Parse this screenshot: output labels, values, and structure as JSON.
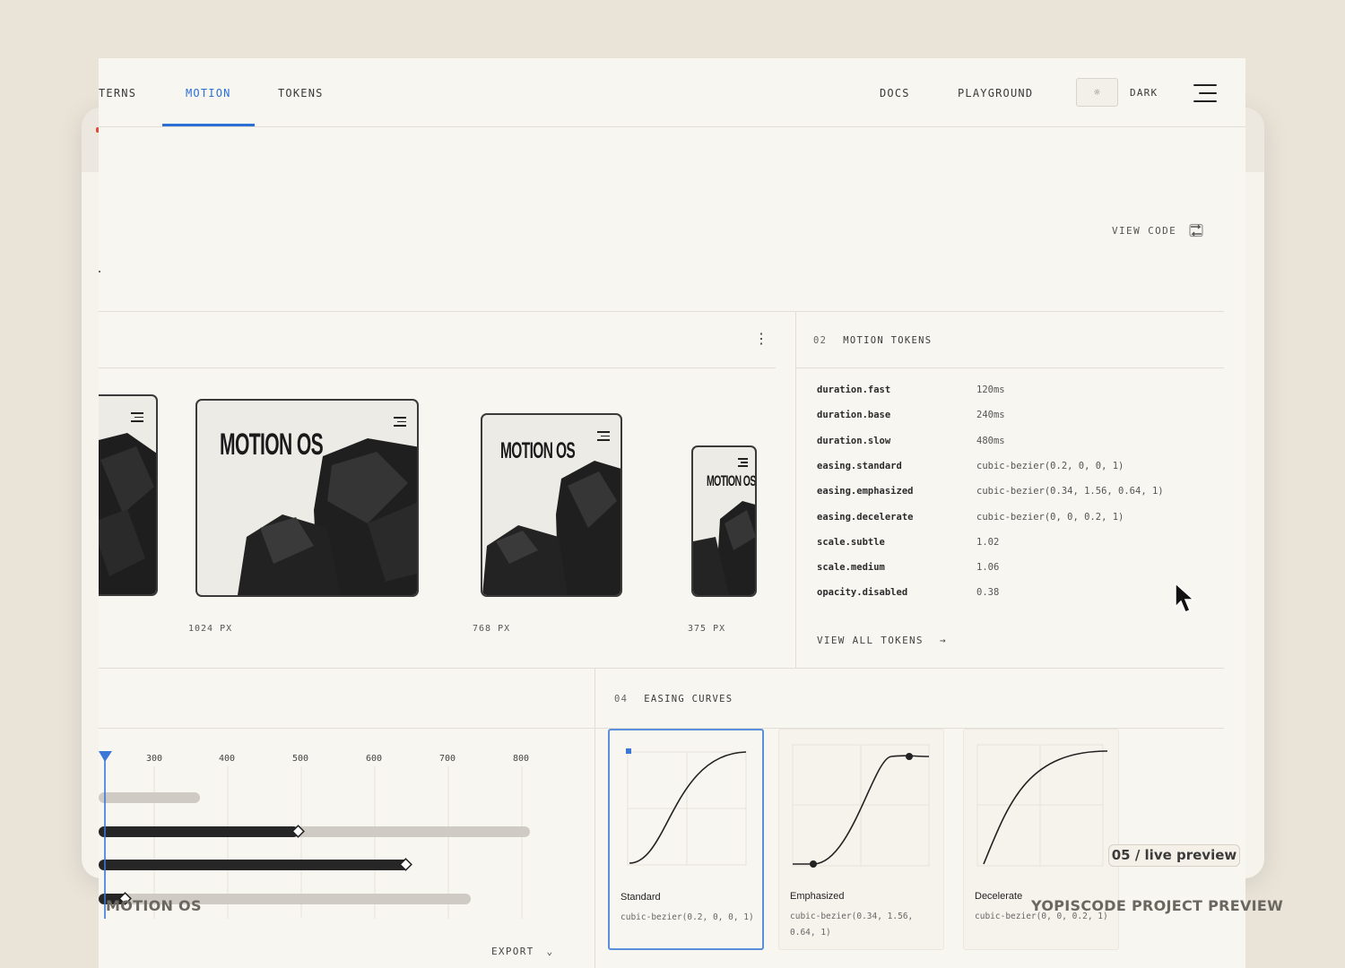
{
  "nav": {
    "tabs": [
      {
        "label": "TERNS"
      },
      {
        "label": "MOTION"
      },
      {
        "label": "TOKENS"
      }
    ],
    "right": [
      {
        "label": "DOCS"
      },
      {
        "label": "PLAYGROUND"
      }
    ],
    "theme_label": "DARK"
  },
  "toolbar": {
    "view_code": "VIEW CODE"
  },
  "devices": [
    {
      "logo": "",
      "label": ""
    },
    {
      "logo": "MOTION OS",
      "label": "1024 PX"
    },
    {
      "logo": "MOTION OS",
      "label": "768 PX"
    },
    {
      "logo": "MOTION OS",
      "label": "375 PX"
    }
  ],
  "tokens": {
    "num": "02",
    "title": "MOTION TOKENS",
    "items": [
      {
        "key": "duration.fast",
        "value": "120ms"
      },
      {
        "key": "duration.base",
        "value": "240ms"
      },
      {
        "key": "duration.slow",
        "value": "480ms"
      },
      {
        "key": "easing.standard",
        "value": "cubic-bezier(0.2, 0, 0, 1)"
      },
      {
        "key": "easing.emphasized",
        "value": "cubic-bezier(0.34, 1.56, 0.64, 1)"
      },
      {
        "key": "easing.decelerate",
        "value": "cubic-bezier(0, 0, 0.2, 1)"
      },
      {
        "key": "scale.subtle",
        "value": "1.02"
      },
      {
        "key": "scale.medium",
        "value": "1.06"
      },
      {
        "key": "opacity.disabled",
        "value": "0.38"
      }
    ],
    "view_all": "VIEW ALL TOKENS"
  },
  "timeline": {
    "ticks": [
      "300",
      "400",
      "500",
      "600",
      "700",
      "800"
    ],
    "export": "EXPORT"
  },
  "curves": {
    "num": "04",
    "title": "EASING CURVES",
    "items": [
      {
        "name": "Standard",
        "value": "cubic-bezier(0.2, 0, 0, 1)"
      },
      {
        "name": "Emphasized",
        "value": "cubic-bezier(0.34, 1.56, 0.64, 1)"
      },
      {
        "name": "Decelerate",
        "value": "cubic-bezier(0, 0, 0.2, 1)"
      }
    ]
  },
  "overlay": {
    "badge": "05 / live preview",
    "left": "MOTION OS",
    "right": "YOPISCODE PROJECT PREVIEW"
  }
}
